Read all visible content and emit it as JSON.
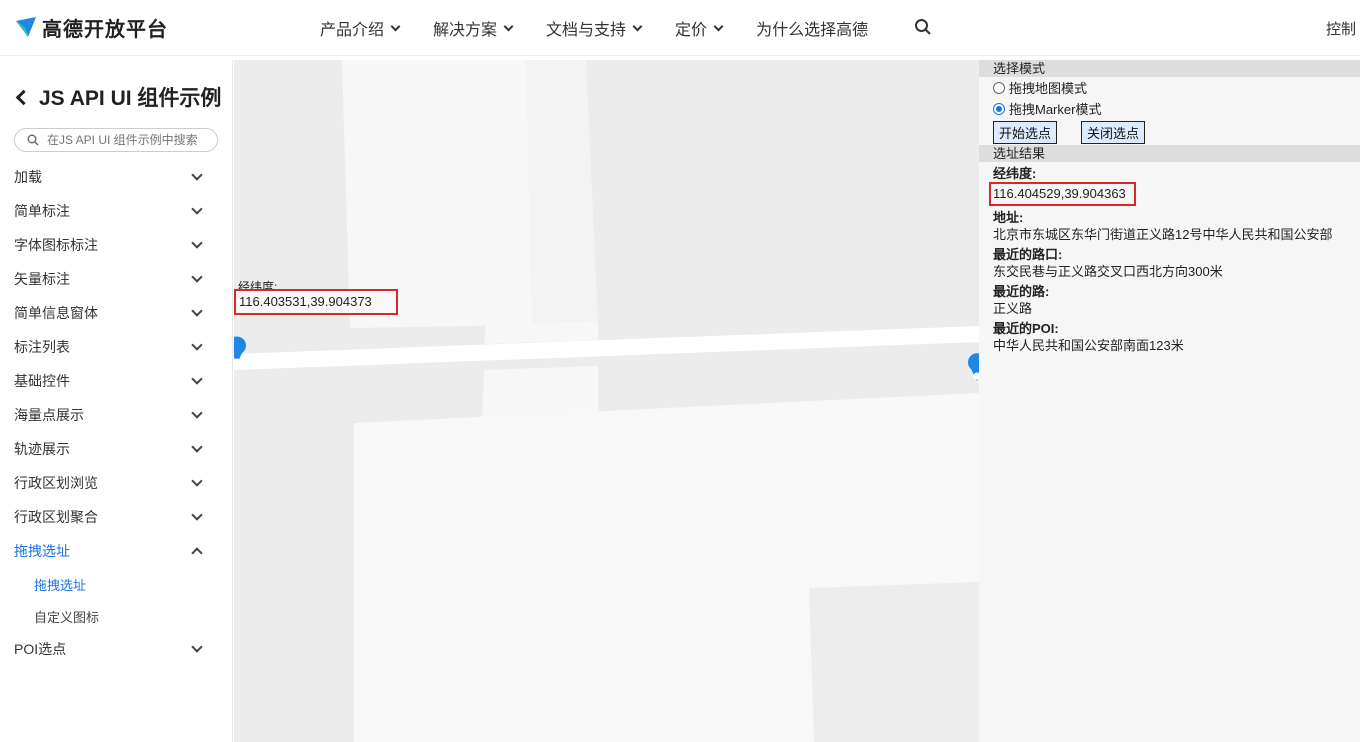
{
  "header": {
    "logo_text": "高德开放平台",
    "nav": [
      {
        "label": "产品介绍",
        "has_dropdown": true
      },
      {
        "label": "解决方案",
        "has_dropdown": true
      },
      {
        "label": "文档与支持",
        "has_dropdown": true
      },
      {
        "label": "定价",
        "has_dropdown": true
      },
      {
        "label": "为什么选择高德",
        "has_dropdown": false
      }
    ],
    "search_icon": "search-icon",
    "console_label": "控制"
  },
  "sidebar": {
    "title": "JS API UI 组件示例",
    "search_placeholder": "在JS API UI 组件示例中搜索",
    "items": [
      {
        "label": "加载",
        "expanded": false
      },
      {
        "label": "简单标注",
        "expanded": false
      },
      {
        "label": "字体图标标注",
        "expanded": false
      },
      {
        "label": "矢量标注",
        "expanded": false
      },
      {
        "label": "简单信息窗体",
        "expanded": false
      },
      {
        "label": "标注列表",
        "expanded": false
      },
      {
        "label": "基础控件",
        "expanded": false
      },
      {
        "label": "海量点展示",
        "expanded": false
      },
      {
        "label": "轨迹展示",
        "expanded": false
      },
      {
        "label": "行政区划浏览",
        "expanded": false
      },
      {
        "label": "行政区划聚合",
        "expanded": false
      },
      {
        "label": "拖拽选址",
        "expanded": true,
        "active": true
      },
      {
        "label": "POI选点",
        "expanded": false
      }
    ],
    "subitems": [
      {
        "label": "拖拽选址",
        "active": true
      },
      {
        "label": "自定义图标",
        "active": false
      }
    ]
  },
  "map": {
    "info_label": "经纬度:",
    "coord": "116.403531,39.904373",
    "marker_color": "#1e88e5"
  },
  "panel": {
    "mode_header": "选择模式",
    "modes": [
      {
        "label": "拖拽地图模式",
        "checked": false
      },
      {
        "label": "拖拽Marker模式",
        "checked": true
      }
    ],
    "buttons": {
      "start": "开始选点",
      "close": "关闭选点"
    },
    "result_header": "选址结果",
    "results": {
      "lnglat_label": "经纬度:",
      "lnglat_value": "116.404529,39.904363",
      "address_label": "地址:",
      "address_value": "北京市东城区东华门街道正义路12号中华人民共和国公安部",
      "cross_label": "最近的路口:",
      "cross_value": "东交民巷与正义路交叉口西北方向300米",
      "road_label": "最近的路:",
      "road_value": "正义路",
      "poi_label": "最近的POI:",
      "poi_value": "中华人民共和国公安部南面123米"
    }
  },
  "colors": {
    "active": "#1a73e8",
    "highlight_box": "#d42a2a",
    "brand_blue": "#1e88e5"
  }
}
